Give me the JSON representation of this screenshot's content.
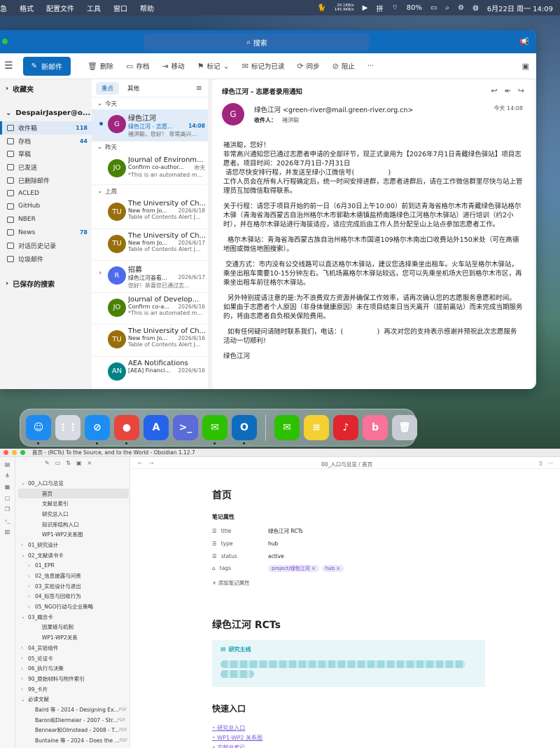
{
  "menubar": {
    "items": [
      "急",
      "格式",
      "配置文件",
      "工具",
      "窗口",
      "帮助"
    ],
    "net_up": "20.1KB/s",
    "net_down": "145.9KB/s",
    "battery": "80%",
    "datetime": "6月22日 周一 14:09"
  },
  "outlook": {
    "search": "搜索",
    "new_mail": "新邮件",
    "toolbar": [
      "删除",
      "存档",
      "移动",
      "标记",
      "标记为已读",
      "同步",
      "阻止",
      "···"
    ],
    "favorites": "收藏夹",
    "account": "DespairJasper@o...",
    "folders": [
      {
        "name": "收件箱",
        "count": "118",
        "sel": true
      },
      {
        "name": "存档",
        "count": "44"
      },
      {
        "name": "草稿",
        "count": ""
      },
      {
        "name": "已发送",
        "count": ""
      },
      {
        "name": "已删除邮件",
        "count": ""
      },
      {
        "name": "ACLED",
        "count": ""
      },
      {
        "name": "GitHub",
        "count": ""
      },
      {
        "name": "NBER",
        "count": ""
      },
      {
        "name": "News",
        "count": "78"
      },
      {
        "name": "对话历史记录",
        "count": ""
      },
      {
        "name": "垃圾邮件",
        "count": ""
      }
    ],
    "saved_search": "已保存的搜索",
    "tabs": [
      "重点",
      "其他"
    ],
    "groups": [
      "今天",
      "昨天",
      "上周"
    ],
    "messages": [
      {
        "group": 0,
        "from": "绿色江河",
        "subject": "绿色江河 - 志愿...",
        "date": "14:08",
        "preview": "褚洪聪，您好！ 非常高兴...",
        "initials": "G",
        "color": "#a0267f",
        "sel": true,
        "unread": true
      },
      {
        "group": 1,
        "from": "Journal of Environm...",
        "subject": "Confirm co-author...",
        "date": "昨天",
        "preview": "*This is an automated m...",
        "initials": "JO",
        "color": "#498205"
      },
      {
        "group": 2,
        "from": "The University of Ch...",
        "subject": "New from Jo...",
        "date": "2026/6/18",
        "preview": "Table of Contents Alert J...",
        "initials": "TU",
        "color": "#986f0b"
      },
      {
        "group": 2,
        "from": "The University of Ch...",
        "subject": "New from Jo...",
        "date": "2026/6/17",
        "preview": "Table of Contents Alert J...",
        "initials": "TU",
        "color": "#986f0b"
      },
      {
        "group": 2,
        "from": "招募",
        "subject": "绿色江河荟看...",
        "date": "2026/6/17",
        "preview": "您好！恭喜您已通过志...",
        "initials": "R",
        "color": "#4f6bed",
        "thread": true
      },
      {
        "group": 2,
        "from": "Journal of Develop...",
        "subject": "Confirm co-a...",
        "date": "2026/6/16",
        "preview": "*This is an automated m...",
        "initials": "JO",
        "color": "#498205"
      },
      {
        "group": 2,
        "from": "The University of Ch...",
        "subject": "New from Jo...",
        "date": "2026/6/16",
        "preview": "Table of Contents Alert J...",
        "initials": "TU",
        "color": "#986f0b"
      },
      {
        "group": 2,
        "from": "AEA Notifications",
        "subject": "[AEA] Financi...",
        "date": "2026/6/16",
        "preview": "",
        "initials": "AN",
        "color": "#038387"
      }
    ],
    "reading": {
      "subject": "绿色江河 - 志愿者录用通知",
      "sender": "绿色江河 <green-river@mail.green-river.org.cn>",
      "to_label": "收件人：",
      "to": "褚洪聪",
      "time": "今天 14:08",
      "initial": "G",
      "body": [
        "褚洪聪，您好！\n非常高兴通知您已通过志愿者申请的全部环节，现正式录用为【2026年7月1日青藏绿色驿站】项目志愿者。项目时间：2026年7月1日-7月31日\n 请您尽快安排行程，并发送至绿小江微信号(                )\n工作人员会在所有人行程确定后，统一时间安排进群，志愿者进群后，请在工作微信群里尽快与站上管理员互加微信取得联系。",
        "关于行程：请您于项目开始的前一日（6月30日上午10:00）前到达青海省格尔木市青藏绿色驿站格尔木驿（青海省海西蒙古自治州格尔木市郭勒木德镇盐桥南路绿色江河格尔木驿站）进行培训（约2小时），并在格尔木驿站进行海拔适应，适应完成后由工作人员分配至山上站点参加志愿者工作。",
        "  格尔木驿站：青海省海西蒙古族自治州格尔木市国道109格尔木南出口收费站外150米处（可在高德地图或微信地图搜索）。",
        " 交通方式：市内没有公交线路可以直达格尔木驿站，建议您选择乘坐出租车。火车站至格尔木驿站，乘坐出租车需要10-15分钟左右。飞机场离格尔木驿站较远，您可以先乘坐机场大巴到格尔木市区，再乘坐出租车前往格尔木驿站。",
        "  另外特别提请注意的是:为不浪费双方资源并确保工作效率，请再次确认您的志愿服务意愿和时间。\n如果由于志愿者个人原因（非身体健康原因）未在项目结束日当天离开（提前离站）而未完成当期服务的，将由志愿者自负相关保险费用。",
        "  如有任何疑问请随时联系我们，电话：(                )  再次对您的支持表示感谢并预祝此次志愿服务 活动一切顺利!",
        "绿色江河"
      ]
    }
  },
  "dock": [
    {
      "name": "finder",
      "glyph": "☺",
      "color": "#1e8bf0",
      "run": true
    },
    {
      "name": "launchpad",
      "glyph": "⋮⋮",
      "color": "#d8dce2",
      "run": false
    },
    {
      "name": "safari",
      "glyph": "⊘",
      "color": "#1c8ef2",
      "run": true
    },
    {
      "name": "chrome",
      "glyph": "●",
      "color": "#e8453c",
      "run": true
    },
    {
      "name": "arc",
      "glyph": "A",
      "color": "#2563eb",
      "run": false
    },
    {
      "name": "terminal",
      "glyph": ">_",
      "color": "#5b6bd8",
      "run": false
    },
    {
      "name": "wechat",
      "glyph": "✉",
      "color": "#2dc100",
      "run": true
    },
    {
      "name": "outlook",
      "glyph": "O",
      "color": "#0f6cbd",
      "run": true
    },
    {
      "name": "wechat-2",
      "glyph": "✉",
      "color": "#2dc100",
      "run": false
    },
    {
      "name": "notes",
      "glyph": "≡",
      "color": "#f5d033",
      "run": false
    },
    {
      "name": "netease-music",
      "glyph": "♪",
      "color": "#e0252d",
      "run": false
    },
    {
      "name": "bilibili",
      "glyph": "b",
      "color": "#fb7299",
      "run": false
    },
    {
      "name": "trash",
      "glyph": "🗑",
      "color": "#c8ccd4",
      "run": false
    }
  ],
  "obsidian": {
    "title": "首页 - (RCTs) To the Source, and to the World - Obsidian 1.12.7",
    "breadcrumb": "00_入口与总览 / 首页",
    "tree": [
      {
        "label": "00_入口与总览",
        "level": 0,
        "caret": "v"
      },
      {
        "label": "首页",
        "level": 2,
        "sel": true
      },
      {
        "label": "文献总索引",
        "level": 2
      },
      {
        "label": "研究总入口",
        "level": 2
      },
      {
        "label": "知识库结构入口",
        "level": 2
      },
      {
        "label": "WP1-WP2关系图",
        "level": 2
      },
      {
        "label": "01_研究设计",
        "level": 0,
        "caret": ">"
      },
      {
        "label": "02_文献读书卡",
        "level": 0,
        "caret": "v"
      },
      {
        "label": "01_EPR",
        "level": 1,
        "caret": ">"
      },
      {
        "label": "02_信息披露与问责",
        "level": 1,
        "caret": ">"
      },
      {
        "label": "03_实验设计与退出",
        "level": 1,
        "caret": ">"
      },
      {
        "label": "04_标签与回收行为",
        "level": 1,
        "caret": ">"
      },
      {
        "label": "05_NGO行动与企业策略",
        "level": 1,
        "caret": ">"
      },
      {
        "label": "03_概念卡",
        "level": 0,
        "caret": "v"
      },
      {
        "label": "因果链与机制",
        "level": 2
      },
      {
        "label": "WP1-WP2关系",
        "level": 2
      },
      {
        "label": "04_实验组件",
        "level": 0,
        "caret": ">"
      },
      {
        "label": "05_论证卡",
        "level": 0,
        "caret": ">"
      },
      {
        "label": "06_执行与决策",
        "level": 0,
        "caret": ">"
      },
      {
        "label": "90_原始材料与附件索引",
        "level": 0,
        "caret": ">"
      },
      {
        "label": "99_卡片",
        "level": 0,
        "caret": ">"
      },
      {
        "label": "必读文献",
        "level": 0,
        "caret": "v"
      },
      {
        "label": "Baird 等 - 2014 - Designing Ex...",
        "level": 2,
        "pdf": "PDF"
      },
      {
        "label": "Baron和Diermeier - 2007 - Str...",
        "level": 2,
        "pdf": "PDF"
      },
      {
        "label": "Bennear和Olmstead - 2008 - T...",
        "level": 2,
        "pdf": "PDF"
      },
      {
        "label": "Buntaine 等 - 2024 - Does the ...",
        "level": 2,
        "pdf": "PDF"
      }
    ],
    "page_title": "首页",
    "props_heading": "笔记属性",
    "props": [
      {
        "key": "title",
        "value": "绿色江河 RCTs",
        "icon": "☰"
      },
      {
        "key": "type",
        "value": "hub",
        "icon": "☰"
      },
      {
        "key": "status",
        "value": "active",
        "icon": "☰"
      },
      {
        "key": "tags",
        "value": "",
        "icon": "⌂"
      }
    ],
    "tags": [
      "project/绿色江河 ×",
      "hub ×"
    ],
    "add_prop": "+ 添加笔记属性",
    "h2": "绿色江河 RCTs",
    "callout_title": "研究主线",
    "h3": "快速入口",
    "links": [
      "研究总入口",
      "WP1-WP2 关系图",
      "文献总索引"
    ]
  }
}
